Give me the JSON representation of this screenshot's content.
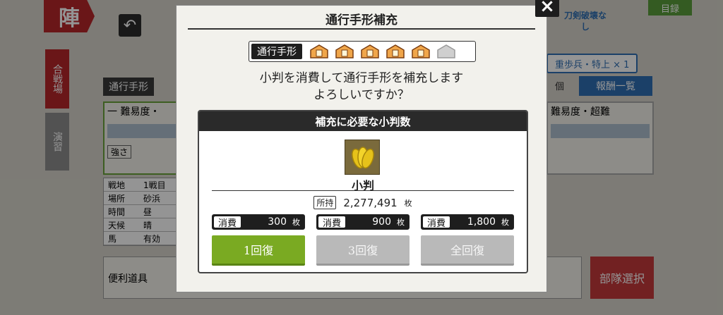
{
  "background": {
    "banner_glyph": "陣",
    "side_tab_1": "合戦場",
    "side_tab_2": "演習",
    "pass_label": "通行手形",
    "difficulty_left": "一 難易度・",
    "difficulty_right": "難易度・超難",
    "strength_label": "強さ",
    "top_right_tab": "目録",
    "emblem_text": "刀剣破壊なし",
    "enemy_info": "重歩兵・特上 × 1",
    "reward_button": "報酬一覧",
    "count_unit": "個",
    "table_rows": [
      "戦地",
      "場所",
      "時間",
      "天候",
      "馬"
    ],
    "table_col2": [
      "1戦目",
      "砂浜",
      "昼",
      "晴",
      "有効"
    ],
    "bottom_label": "便利道具",
    "formation_button": "部隊選択"
  },
  "dialog": {
    "title": "通行手形補充",
    "close_label": "×",
    "pass_label": "通行手形",
    "pass_filled": 5,
    "pass_total": 6,
    "message_line1": "小判を消費して通行手形を補充します",
    "message_line2": "よろしいですか？",
    "cost_header": "補充に必要な小判数",
    "item_name": "小判",
    "owned_tag": "所持",
    "owned_value": "2,277,491",
    "unit": "枚",
    "options": [
      {
        "cost_label": "消費",
        "cost": "300",
        "unit": "枚",
        "button": "1回復",
        "enabled": true
      },
      {
        "cost_label": "消費",
        "cost": "900",
        "unit": "枚",
        "button": "3回復",
        "enabled": false
      },
      {
        "cost_label": "消費",
        "cost": "1,800",
        "unit": "枚",
        "button": "全回復",
        "enabled": false
      }
    ]
  },
  "colors": {
    "confirm_green": "#7aaa22",
    "disabled_grey": "#b9b9b9",
    "accent_red": "#b7262a",
    "accent_blue": "#2f6fb3"
  }
}
